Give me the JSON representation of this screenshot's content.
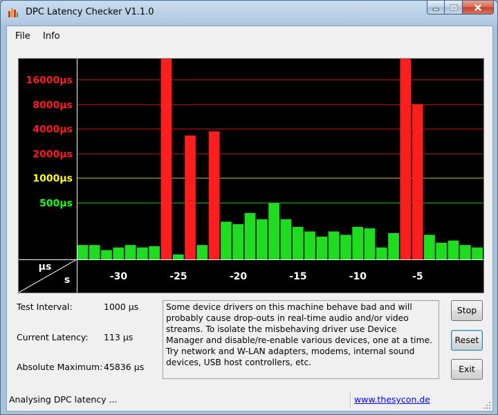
{
  "window": {
    "title": "DPC Latency Checker V1.1.0"
  },
  "menu": [
    "File",
    "Info"
  ],
  "chart_data": {
    "type": "bar",
    "title": "",
    "xlabel": "s",
    "ylabel": "µs",
    "y_tick_labels": [
      {
        "label": "16000µs",
        "color": "#ff1e1e"
      },
      {
        "label": "8000µs",
        "color": "#ff1e1e"
      },
      {
        "label": "4000µs",
        "color": "#ff1e1e"
      },
      {
        "label": "2000µs",
        "color": "#ff1e1e"
      },
      {
        "label": "1000µs",
        "color": "#ffff1e"
      },
      {
        "label": "500µs",
        "color": "#1eff1e"
      }
    ],
    "y_tick_values": [
      16000,
      8000,
      4000,
      2000,
      1000,
      500
    ],
    "y_scale": "log",
    "x_ticks": [
      -30,
      -25,
      -20,
      -15,
      -10,
      -5
    ],
    "x_tick_labels": [
      "-30",
      "-25",
      "-20",
      "-15",
      "-10",
      "-5"
    ],
    "x": [
      -33,
      -32,
      -31,
      -30,
      -29,
      -28,
      -27,
      -26,
      -25,
      -24,
      -23,
      -22,
      -21,
      -20,
      -19,
      -18,
      -17,
      -16,
      -15,
      -14,
      -13,
      -12,
      -11,
      -10,
      -9,
      -8,
      -7,
      -6,
      -5,
      -4,
      -3,
      -2,
      -1,
      0
    ],
    "values": [
      150,
      150,
      130,
      140,
      150,
      140,
      145,
      45836,
      115,
      3300,
      150,
      3700,
      290,
      270,
      370,
      310,
      490,
      310,
      250,
      220,
      190,
      220,
      200,
      250,
      240,
      140,
      210,
      45836,
      8000,
      200,
      160,
      170,
      150,
      140
    ],
    "ylim": [
      100,
      16000
    ],
    "xlim": [
      -33.5,
      0.5
    ],
    "grid": true,
    "colors": {
      "normal": "#1edc1e",
      "warning": "#ffff1e",
      "critical": "#ff1e1e",
      "background": "#000000"
    }
  },
  "stats": {
    "test_interval_label": "Test Interval:",
    "test_interval_value": "1000 µs",
    "current_latency_label": "Current Latency:",
    "current_latency_value": "113 µs",
    "absolute_max_label": "Absolute Maximum:",
    "absolute_max_value": "45836 µs"
  },
  "message": "Some device drivers on this machine behave bad and will probably cause drop-outs in real-time audio and/or video streams. To isolate the misbehaving driver use Device Manager and disable/re-enable various devices, one at a time. Try network and W-LAN adapters, modems, internal sound devices, USB host controllers, etc.",
  "buttons": {
    "stop": "Stop",
    "reset": "Reset",
    "exit": "Exit"
  },
  "status": {
    "text": "Analysing DPC latency ...",
    "link": "www.thesycon.de"
  }
}
